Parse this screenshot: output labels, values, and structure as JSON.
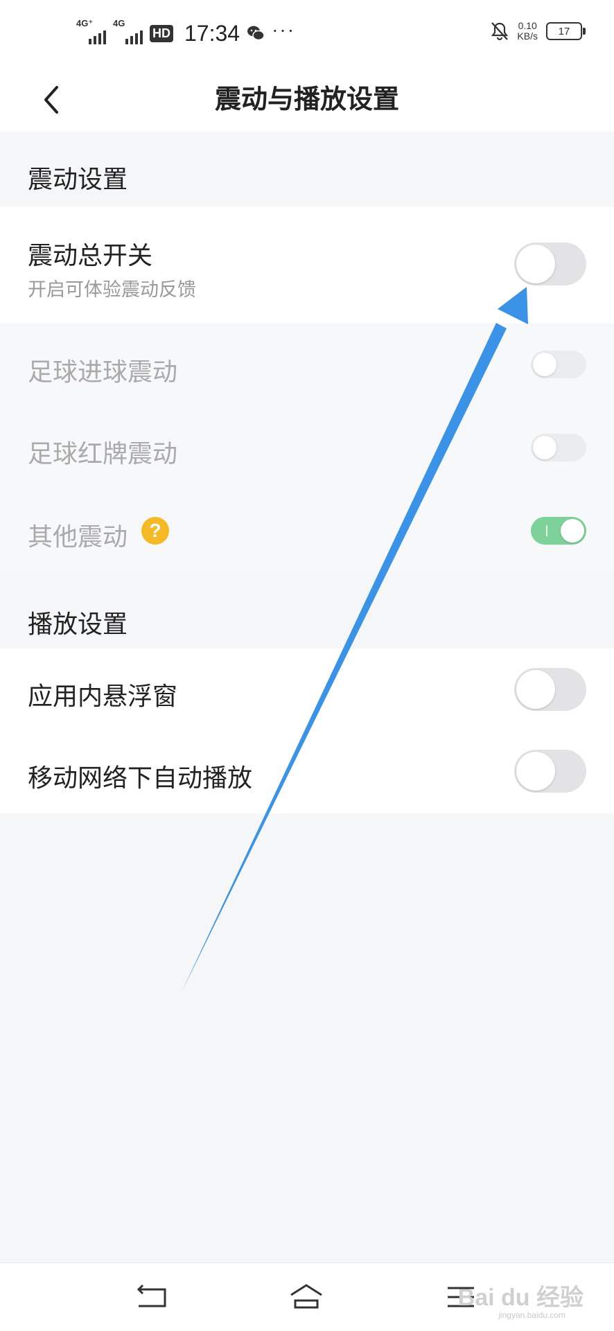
{
  "status_bar": {
    "network1": "4G⁺",
    "network2": "4G",
    "hd": "HD",
    "time": "17:34",
    "more": "···",
    "speed_value": "0.10",
    "speed_unit": "KB/s",
    "battery": "17"
  },
  "header": {
    "title": "震动与播放设置"
  },
  "vibration_section": {
    "title": "震动设置",
    "master": {
      "label": "震动总开关",
      "sublabel": "开启可体验震动反馈",
      "on": false
    },
    "items": [
      {
        "label": "足球进球震动",
        "on": false,
        "enabled": false
      },
      {
        "label": "足球红牌震动",
        "on": false,
        "enabled": false
      },
      {
        "label": "其他震动",
        "on": true,
        "enabled": false,
        "help": "?"
      }
    ]
  },
  "playback_section": {
    "title": "播放设置",
    "items": [
      {
        "label": "应用内悬浮窗",
        "on": false
      },
      {
        "label": "移动网络下自动播放",
        "on": false
      }
    ]
  },
  "watermark": {
    "brand": "Bai du 经验",
    "url": "jingyan.baidu.com"
  },
  "colors": {
    "accent_arrow": "#3a93e6",
    "toggle_on": "#7fd19a",
    "help": "#f5b926"
  }
}
